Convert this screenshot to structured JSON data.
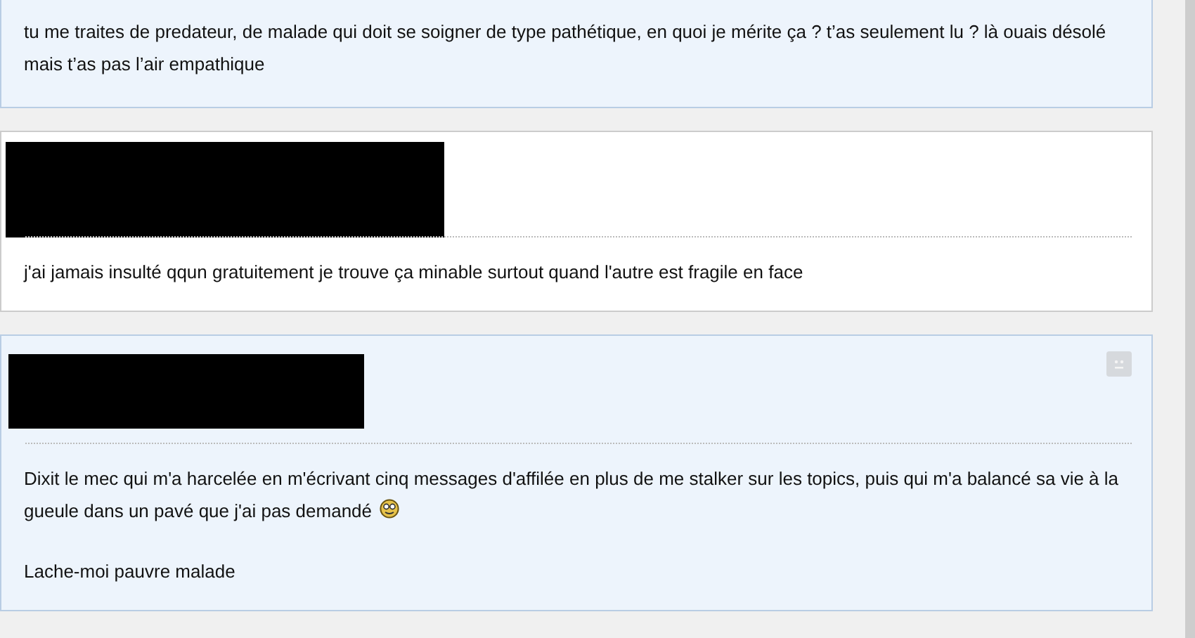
{
  "posts": [
    {
      "highlighted": true,
      "redacted_header": false,
      "paragraphs": [
        {
          "text": "tu me traites de predateur, de malade qui doit se soigner de type pathétique, en quoi je mérite ça ? t’as seulement lu ? là ouais désolé mais t’as pas l’air empathique"
        }
      ]
    },
    {
      "highlighted": false,
      "redacted_header": true,
      "paragraphs": [
        {
          "text": "j'ai jamais insulté qqun gratuitement je trouve ça minable surtout quand l'autre est fragile en face"
        }
      ]
    },
    {
      "highlighted": true,
      "redacted_header": true,
      "report_button": true,
      "paragraphs": [
        {
          "text": "Dixit le mec qui m'a harcelée en m'écrivant cinq messages d'affilée en plus de me stalker sur les topics, puis qui m'a balancé sa vie à la gueule dans un pavé que j'ai pas demandé",
          "smiley": true
        },
        {
          "text": "Lache-moi pauvre malade"
        }
      ]
    }
  ]
}
